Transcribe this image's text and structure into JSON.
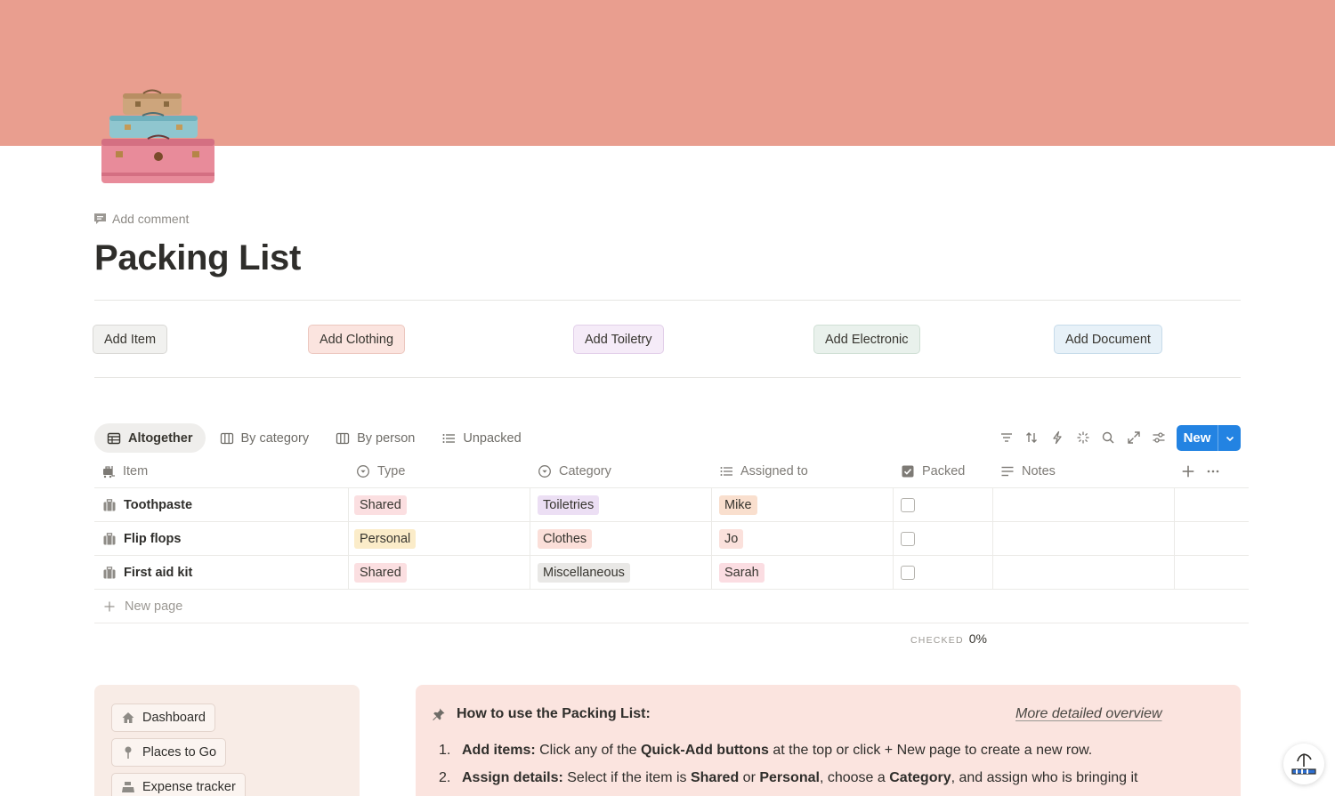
{
  "page": {
    "title": "Packing List",
    "add_comment": "Add comment",
    "cover_color": "#e99e8f",
    "icon": "stacked-suitcases-icon"
  },
  "quick_add": [
    {
      "label": "Add Item",
      "bg": "#f1f1ef",
      "border": "#d9d8d5"
    },
    {
      "label": "Add Clothing",
      "bg": "#fbe4df",
      "border": "#ecc7bf"
    },
    {
      "label": "Add Toiletry",
      "bg": "#f5ebf8",
      "border": "#e2cfe9"
    },
    {
      "label": "Add Electronic",
      "bg": "#e9f1ec",
      "border": "#cfdfd4"
    },
    {
      "label": "Add Document",
      "bg": "#e7f1f8",
      "border": "#c6dbea"
    }
  ],
  "views": [
    {
      "label": "Altogether",
      "icon": "table-icon",
      "active": true
    },
    {
      "label": "By category",
      "icon": "board-icon",
      "active": false
    },
    {
      "label": "By person",
      "icon": "board-icon",
      "active": false
    },
    {
      "label": "Unpacked",
      "icon": "list-icon",
      "active": false
    }
  ],
  "toolbar": {
    "icons": [
      "filter-icon",
      "sort-icon",
      "automation-icon",
      "ai-sparkle-icon",
      "search-icon",
      "expand-icon",
      "settings-icon"
    ],
    "new_label": "New"
  },
  "table": {
    "columns": [
      {
        "label": "Item",
        "icon": "suitcase-cart-icon"
      },
      {
        "label": "Type",
        "icon": "select-icon"
      },
      {
        "label": "Category",
        "icon": "select-icon"
      },
      {
        "label": "Assigned to",
        "icon": "multi-select-icon"
      },
      {
        "label": "Packed",
        "icon": "checkbox-icon"
      },
      {
        "label": "Notes",
        "icon": "text-icon"
      }
    ],
    "rows": [
      {
        "item": "Toothpaste",
        "type": "Shared",
        "category": "Toiletries",
        "assigned": "Mike",
        "packed": false,
        "notes": ""
      },
      {
        "item": "Flip flops",
        "type": "Personal",
        "category": "Clothes",
        "assigned": "Jo",
        "packed": false,
        "notes": ""
      },
      {
        "item": "First aid kit",
        "type": "Shared",
        "category": "Miscellaneous",
        "assigned": "Sarah",
        "packed": false,
        "notes": ""
      }
    ],
    "new_page": "New page",
    "calc_label": "CHECKED",
    "calc_value": "0%"
  },
  "tag_colors": {
    "Shared": "#fbdfe1",
    "Personal": "#fbecc9",
    "Toiletries": "#ecdff4",
    "Clothes": "#fbdfd9",
    "Miscellaneous": "#e9e8e6",
    "Mike": "#f9dfce",
    "Jo": "#fbe1dc",
    "Sarah": "#fbdde2"
  },
  "nav": [
    {
      "label": "Dashboard",
      "icon": "home-icon"
    },
    {
      "label": "Places to Go",
      "icon": "pin-icon"
    },
    {
      "label": "Expense tracker",
      "icon": "cash-register-icon"
    }
  ],
  "how_to": {
    "title": "How to use the Packing List:",
    "link": "More detailed overview",
    "steps": [
      {
        "num": "1.",
        "parts": [
          {
            "t": "Add items:",
            "b": true
          },
          {
            "t": " Click any of the ",
            "b": false
          },
          {
            "t": "Quick-Add buttons",
            "b": true
          },
          {
            "t": " at the top or click + New page to create a new row.",
            "b": false
          }
        ]
      },
      {
        "num": "2.",
        "parts": [
          {
            "t": "Assign details:",
            "b": true
          },
          {
            "t": " Select if the item is ",
            "b": false
          },
          {
            "t": "Shared",
            "b": true
          },
          {
            "t": " or ",
            "b": false
          },
          {
            "t": "Personal",
            "b": true
          },
          {
            "t": ", choose a ",
            "b": false
          },
          {
            "t": "Category",
            "b": true
          },
          {
            "t": ", and assign who is bringing it",
            "b": false
          }
        ]
      }
    ]
  }
}
